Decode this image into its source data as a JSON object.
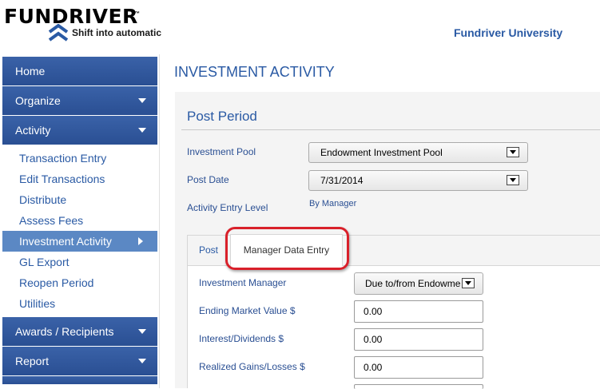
{
  "header": {
    "logo_text": "FUNDRIVER",
    "logo_tm": "™",
    "tagline": "Shift into automatic",
    "organization": "Fundriver University"
  },
  "sidebar": {
    "sections": [
      {
        "label": "Home"
      },
      {
        "label": "Organize"
      },
      {
        "label": "Activity"
      }
    ],
    "activity_items": [
      {
        "label": "Transaction Entry"
      },
      {
        "label": "Edit Transactions"
      },
      {
        "label": "Distribute"
      },
      {
        "label": "Assess Fees"
      },
      {
        "label": "Investment Activity"
      },
      {
        "label": "GL Export"
      },
      {
        "label": "Reopen Period"
      },
      {
        "label": "Utilities"
      }
    ],
    "bottom_sections": [
      {
        "label": "Awards / Recipients"
      },
      {
        "label": "Report"
      }
    ]
  },
  "main": {
    "page_title": "INVESTMENT ACTIVITY",
    "section_title": "Post Period",
    "fields": {
      "investment_pool": {
        "label": "Investment Pool",
        "value": "Endowment Investment Pool"
      },
      "post_date": {
        "label": "Post Date",
        "value": "7/31/2014"
      },
      "entry_level": {
        "label": "Activity Entry Level",
        "value": "By Manager"
      }
    },
    "tabs": [
      {
        "label": "Post"
      },
      {
        "label": "Manager Data Entry"
      }
    ],
    "manager_form": {
      "investment_manager": {
        "label": "Investment Manager",
        "value": "Due to/from Endowme"
      },
      "ending_market_value": {
        "label": "Ending Market Value $",
        "value": "0.00"
      },
      "interest_dividends": {
        "label": "Interest/Dividends $",
        "value": "0.00"
      },
      "realized_gains": {
        "label": "Realized Gains/Losses $",
        "value": "0.00"
      }
    }
  },
  "colors": {
    "nav_blue": "#2a4f93",
    "link_blue": "#2a5aa4",
    "active_item": "#5b88c4",
    "highlight_red": "#d9202a"
  }
}
